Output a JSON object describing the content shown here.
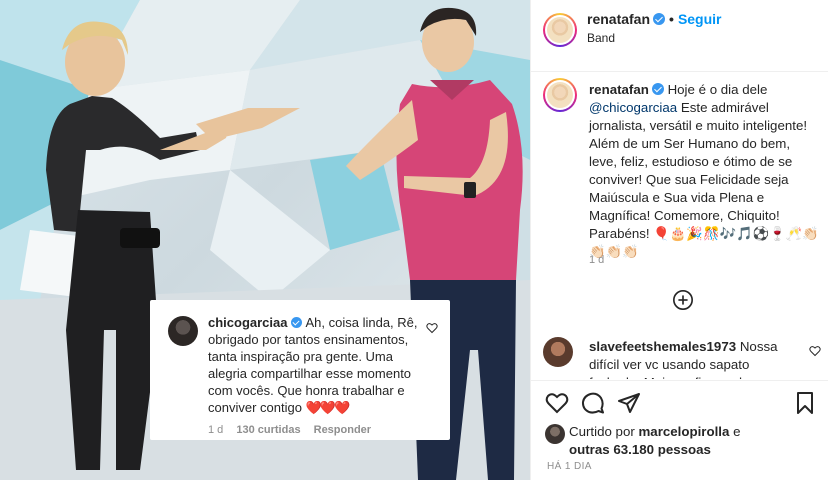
{
  "header": {
    "username": "renatafan",
    "follow_label": "Seguir",
    "separator": "•",
    "location": "Band"
  },
  "caption": {
    "username": "renatafan",
    "text_before_mention": "Hoje é o dia dele",
    "mention": "@chicogarciaa",
    "text_after_mention": "Este admirável jornalista, versátil e muito inteligente! Além de um Ser Humano do bem, leve, feliz, estudioso e ótimo de se conviver! Que sua Felicidade seja Maiúscula e Sua vida Plena e Magnífica! Comemore, Chiquito! Parabéns! 🎈🎂🎉🎊🎶🎵⚽🍷🥂👏🏻👏🏻👏🏻👏🏻",
    "time": "1 d"
  },
  "overlay_comment": {
    "username": "chicogarciaa",
    "text": "Ah, coisa linda, Rê, obrigado por tantos ensinamentos, tanta inspiração pra gente. Uma alegria compartilhar esse momento com vocês. Que honra trabalhar e conviver contigo",
    "hearts": "❤️❤️❤️",
    "time": "1 d",
    "likes": "130 curtidas",
    "reply_label": "Responder"
  },
  "comments": [
    {
      "username": "slavefeetshemales1973",
      "text": "Nossa difícil ver vc usando sapato fechado. Mais prefiro ve de"
    }
  ],
  "likes": {
    "prefix": "Curtido por",
    "user": "marcelopirolla",
    "connector": "e",
    "others": "outras 63.180 pessoas"
  },
  "posted_ago": "HÁ 1 DIA",
  "colors": {
    "accent": "#0095f6",
    "verified": "#3897f0",
    "muted": "#8e8e8e",
    "heart_red": "#ed4956"
  },
  "icons": {
    "like": "heart-outline-icon",
    "comment": "speech-bubble-icon",
    "share": "paper-plane-icon",
    "save": "bookmark-icon",
    "load_more": "plus-circle-icon"
  }
}
